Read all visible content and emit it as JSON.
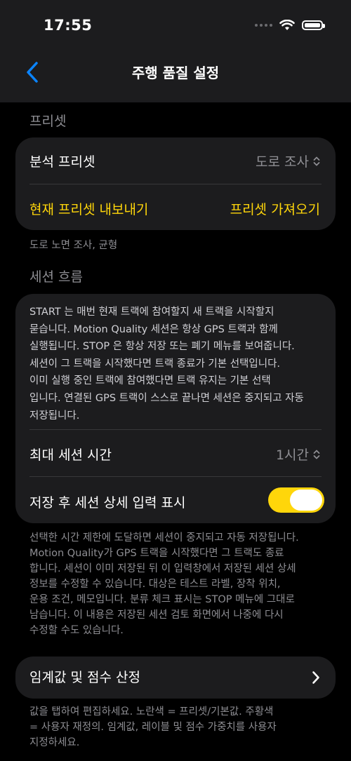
{
  "status": {
    "time": "17:55"
  },
  "nav": {
    "title": "주행 품질 설정"
  },
  "preset": {
    "section": "프리셋",
    "analysis_label": "분석 프리셋",
    "analysis_value": "도로 조사",
    "export_label": "현재 프리셋 내보내기",
    "import_label": "프리셋 가져오기",
    "footnote": "도로 노면 조사, 균형"
  },
  "session": {
    "section": "세션 흐름",
    "description_lines": [
      "START 는 매번 현재 트랙에 참여할지 새 트랙을 시작할지",
      "묻습니다. Motion Quality 세션은 항상 GPS 트랙과 함께",
      "실행됩니다. STOP 은 항상 저장 또는 폐기 메뉴를 보여줍니다.",
      "세션이 그 트랙을 시작했다면 트랙 종료가 기본 선택입니다.",
      "이미 실행 중인 트랙에 참여했다면 트랙 유지는 기본 선택",
      "입니다. 연결된 GPS 트랙이 스스로 끝나면 세션은 중지되고 자동",
      "저장됩니다."
    ],
    "max_time_label": "최대 세션 시간",
    "max_time_value": "1시간",
    "show_details_label": "저장 후 세션 상세 입력 표시",
    "show_details_on": true,
    "footnote_lines": [
      "선택한 시간 제한에 도달하면 세션이 중지되고 자동 저장됩니다.",
      "Motion Quality가 GPS 트랙을 시작했다면 그 트랙도 종료",
      "합니다. 세션이 이미 저장된 뒤 이 입력창에서 저장된 세션 상세",
      "정보를 수정할 수 있습니다. 대상은 테스트 라벨, 장착 위치,",
      "운용 조건, 메모입니다. 분류 체크 표시는 STOP 메뉴에 그대로",
      "남습니다. 이 내용은 저장된 세션 검토 화면에서 나중에 다시",
      "수정할 수도 있습니다."
    ]
  },
  "threshold": {
    "label": "임계값 및 점수 산정",
    "footnote_lines": [
      "값을 탭하여 편집하세요. 노란색 = 프리셋/기본값. 주황색",
      "= 사용자 재정의. 임계값, 레이블 및 점수 가중치를 사용자",
      "지정하세요."
    ]
  },
  "colors": {
    "accent": "#ffd60a",
    "back": "#0a84ff",
    "card": "#1c1c1e",
    "background": "#000000"
  }
}
